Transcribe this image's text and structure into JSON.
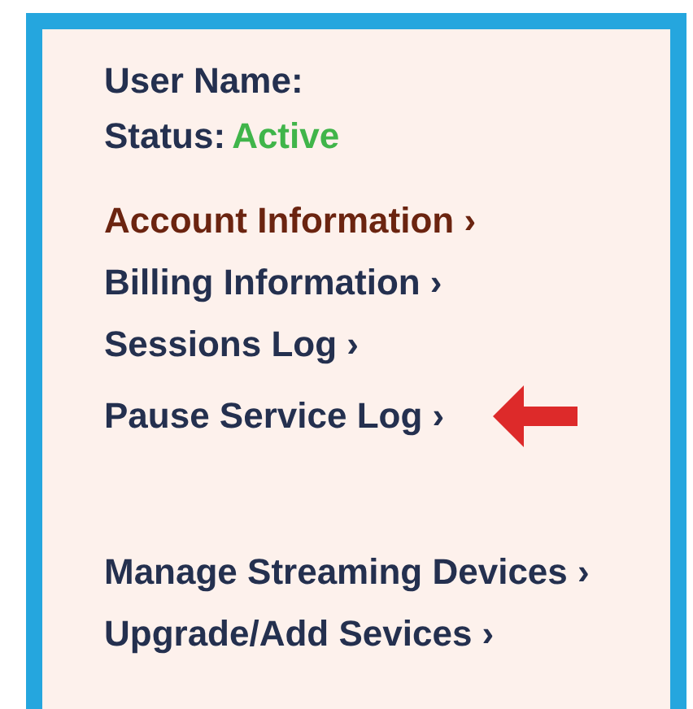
{
  "profile": {
    "user_label": "User Name:",
    "status_label": "Status:",
    "status_value": "Active"
  },
  "link_groups": [
    [
      {
        "kind": "plain",
        "label": "Account Information ›",
        "color": "#6b2410"
      },
      {
        "kind": "plain",
        "label": "Billing Information ›",
        "color": "#24304f"
      },
      {
        "kind": "plain",
        "label": "Sessions Log ›",
        "color": "#24304f"
      },
      {
        "kind": "arrowed",
        "label": "Pause Service Log ›",
        "color": "#24304f"
      }
    ],
    [
      {
        "kind": "plain",
        "label": "Manage Streaming Devices ›",
        "color": "#24304f"
      },
      {
        "kind": "plain",
        "label": "Upgrade/Add Sevices ›",
        "color": "#24304f"
      }
    ]
  ]
}
